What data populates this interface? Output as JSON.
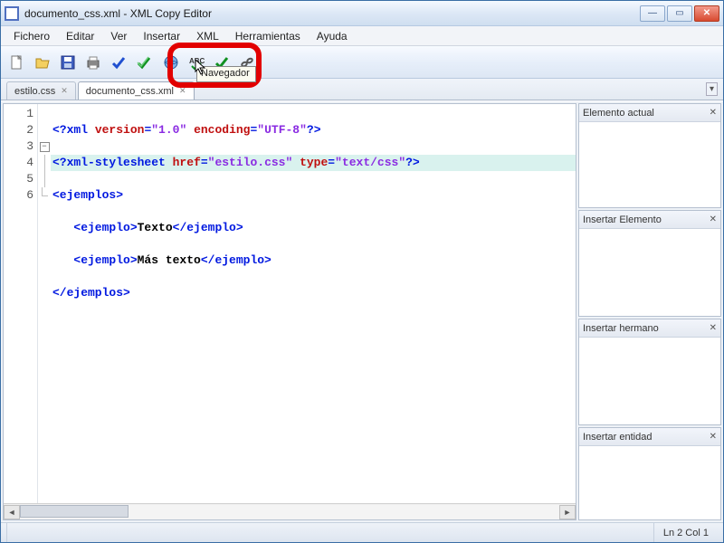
{
  "window": {
    "title": "documento_css.xml - XML Copy Editor"
  },
  "menu": {
    "fichero": "Fichero",
    "editar": "Editar",
    "ver": "Ver",
    "insertar": "Insertar",
    "xml": "XML",
    "herramientas": "Herramientas",
    "ayuda": "Ayuda"
  },
  "toolbar": {
    "tooltip_browser": "Navegador",
    "icons": {
      "new": "new-file-icon",
      "open": "open-folder-icon",
      "save": "save-floppy-icon",
      "print": "printer-icon",
      "check_blue": "check-blue-icon",
      "check_green": "check-green-icon",
      "browser": "globe-browser-icon",
      "spell": "spellcheck-icon",
      "check_green2": "check-green-icon",
      "link": "hyperlink-icon"
    }
  },
  "tabs": [
    {
      "label": "estilo.css",
      "active": false
    },
    {
      "label": "documento_css.xml",
      "active": true
    }
  ],
  "code": {
    "lines": [
      {
        "n": "1",
        "fold": "",
        "pre": "<?",
        "pi": "xml",
        "rest_attr": " version",
        "rest_eq1": "=",
        "rest_str1": "\"1.0\"",
        "rest_attr2": " encoding",
        "rest_eq2": "=",
        "rest_str2": "\"UTF-8\"",
        "end": "?>"
      },
      {
        "n": "2",
        "fold": "",
        "hl": true,
        "pre": "<?",
        "pi": "xml-stylesheet",
        "rest_attr": " href",
        "rest_eq1": "=",
        "rest_str1": "\"estilo.css\"",
        "rest_attr2": " type",
        "rest_eq2": "=",
        "rest_str2": "\"text/css\"",
        "end": "?>"
      },
      {
        "n": "3",
        "fold": "box",
        "indent": "",
        "open": "<ejemplos>"
      },
      {
        "n": "4",
        "fold": "line",
        "indent": "   ",
        "open": "<ejemplo>",
        "text": "Texto",
        "close": "</ejemplo>"
      },
      {
        "n": "5",
        "fold": "line",
        "indent": "   ",
        "open": "<ejemplo>",
        "text": "Más texto",
        "close": "</ejemplo>"
      },
      {
        "n": "6",
        "fold": "end",
        "indent": "",
        "open": "</ejemplos>"
      }
    ]
  },
  "panels": {
    "p1": "Elemento actual",
    "p2": "Insertar Elemento",
    "p3": "Insertar hermano",
    "p4": "Insertar entidad"
  },
  "status": {
    "position": "Ln 2 Col 1"
  }
}
